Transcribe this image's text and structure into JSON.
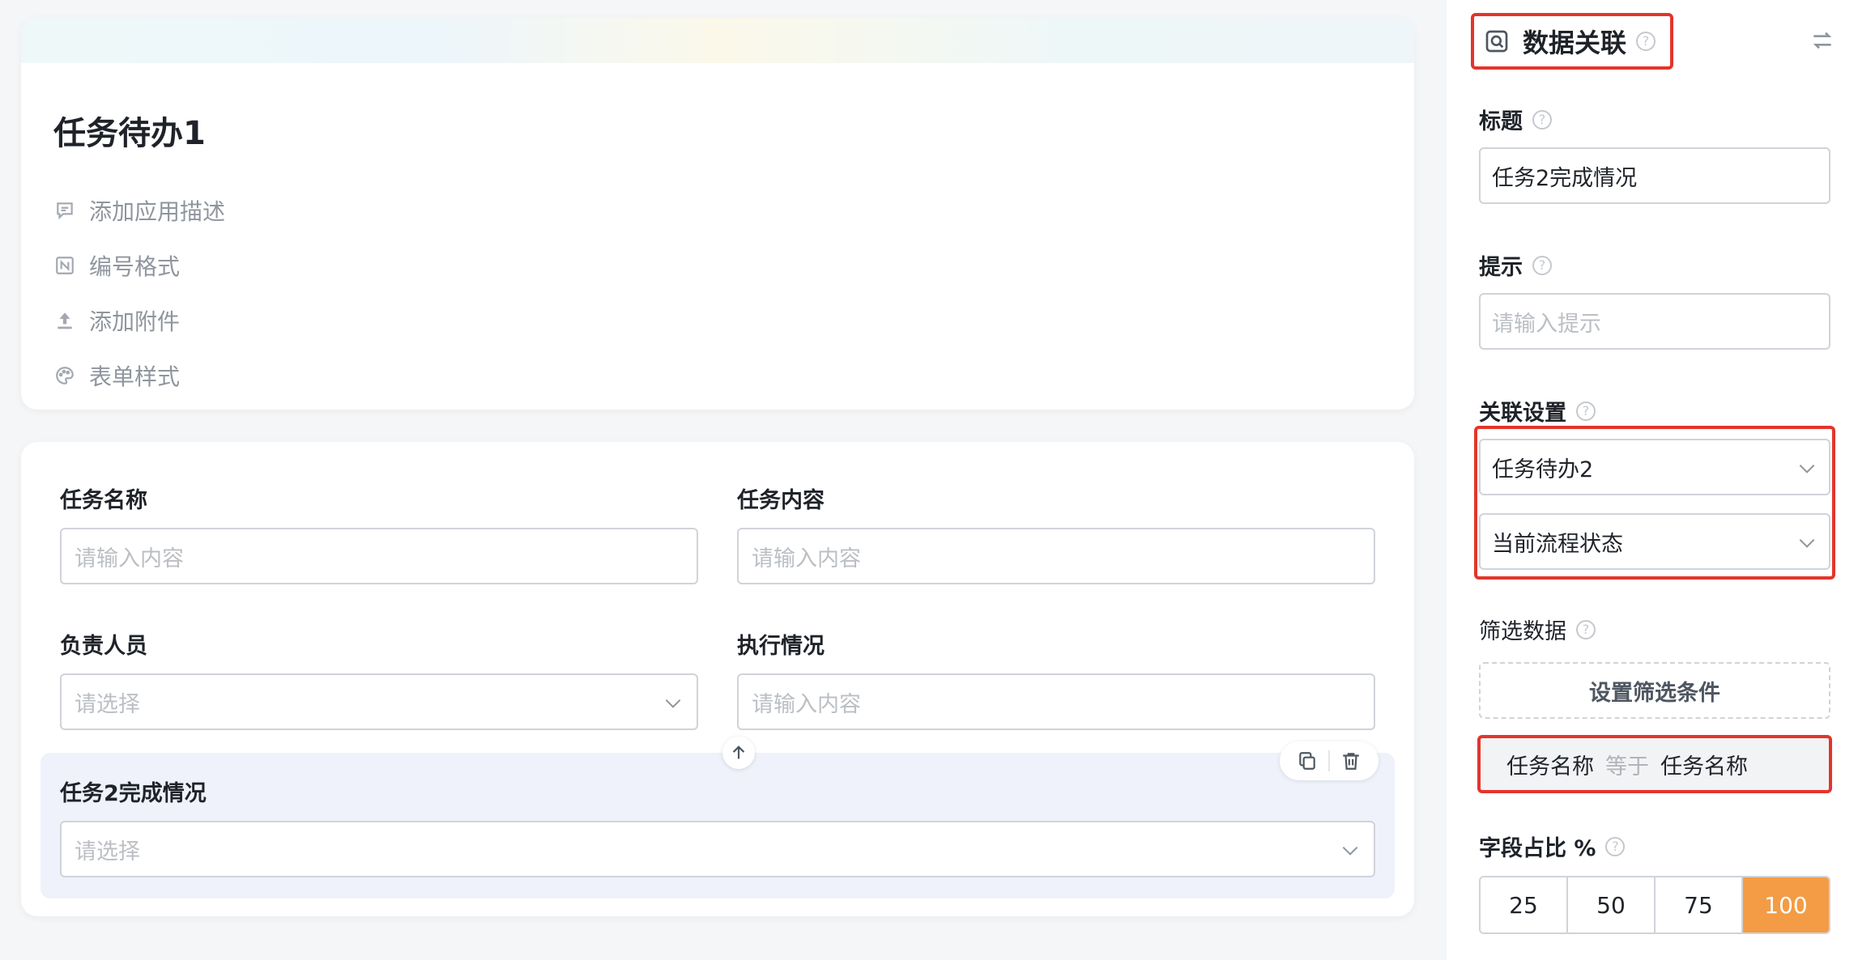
{
  "form": {
    "title": "任务待办1",
    "meta_items": [
      {
        "label": "添加应用描述",
        "icon": "comment-icon"
      },
      {
        "label": "编号格式",
        "icon": "number-format-icon"
      },
      {
        "label": "添加附件",
        "icon": "upload-icon"
      },
      {
        "label": "表单样式",
        "icon": "palette-icon"
      }
    ],
    "fields": [
      {
        "label": "任务名称",
        "placeholder": "请输入内容",
        "type": "text"
      },
      {
        "label": "任务内容",
        "placeholder": "请输入内容",
        "type": "text"
      },
      {
        "label": "负责人员",
        "placeholder": "请选择",
        "type": "select"
      },
      {
        "label": "执行情况",
        "placeholder": "请输入内容",
        "type": "text"
      },
      {
        "label": "任务2完成情况",
        "placeholder": "请选择",
        "type": "select"
      }
    ]
  },
  "panel": {
    "title": "数据关联",
    "title_label": "标题",
    "title_value": "任务2完成情况",
    "hint_label": "提示",
    "hint_placeholder": "请输入提示",
    "assoc_label": "关联设置",
    "assoc_form": "任务待办2",
    "assoc_field": "当前流程状态",
    "filter_label": "筛选数据",
    "filter_button": "设置筛选条件",
    "condition": {
      "field": "任务名称",
      "operator": "等于",
      "value": "任务名称"
    },
    "ratio_label": "字段占比 %",
    "ratio_options": [
      "25",
      "50",
      "75",
      "100"
    ],
    "ratio_selected": "100",
    "help_glyph": "?"
  },
  "colors": {
    "accent": "#f39c45",
    "highlight_border": "#e3352b",
    "selected_field_bg": "#eff2fb"
  }
}
